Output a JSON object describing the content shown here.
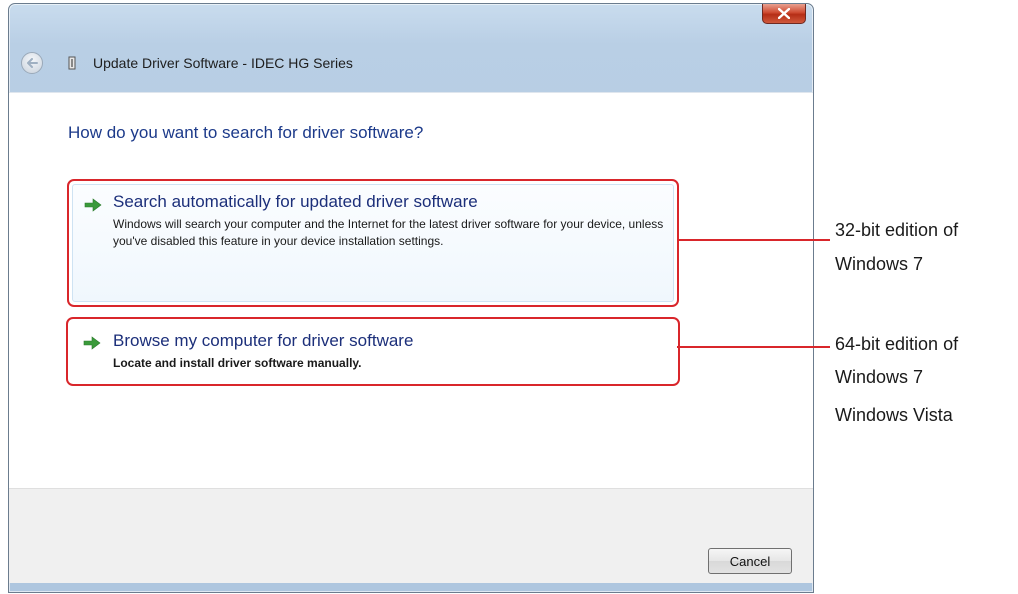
{
  "window": {
    "title": "Update Driver Software - IDEC HG Series",
    "close_label": "x"
  },
  "content": {
    "heading": "How do you want to search for driver software?",
    "options": [
      {
        "title": "Search automatically for updated driver software",
        "description": "Windows will search your computer and the Internet for the latest driver software for your device, unless you've disabled this feature in your device installation settings."
      },
      {
        "title": "Browse my computer for driver software",
        "description": "Locate and install driver software manually."
      }
    ]
  },
  "footer": {
    "cancel_label": "Cancel"
  },
  "callouts": [
    {
      "lines": [
        "32-bit edition of",
        "Windows 7"
      ]
    },
    {
      "lines": [
        "64-bit edition of",
        "Windows 7",
        "Windows Vista"
      ]
    }
  ],
  "colors": {
    "callout_red": "#d9262b",
    "heading_blue": "#1c3a8a",
    "arrow_green": "#3a9a3a"
  },
  "icons": [
    "back-arrow-icon",
    "app-icon",
    "close-icon",
    "green-arrow-icon"
  ]
}
